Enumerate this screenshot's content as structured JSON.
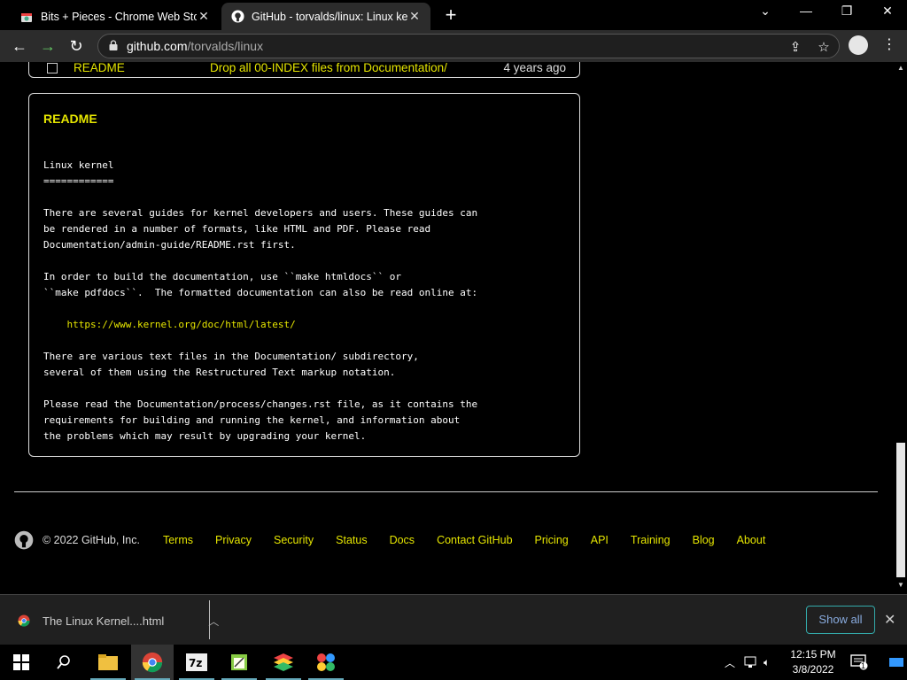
{
  "tabs": [
    {
      "title": "Bits + Pieces - Chrome Web Store",
      "active": false
    },
    {
      "title": "GitHub - torvalds/linux: Linux kernel",
      "active": true
    }
  ],
  "toolbar": {
    "url_host": "github.com",
    "url_path": "/torvalds/linux"
  },
  "file_row": {
    "name": "README",
    "message": "Drop all 00-INDEX files from Documentation/",
    "age": "4 years ago"
  },
  "readme": {
    "heading": "README",
    "title": "Linux kernel",
    "underline": "============",
    "p1": "There are several guides for kernel developers and users. These guides can\nbe rendered in a number of formats, like HTML and PDF. Please read\nDocumentation/admin-guide/README.rst first.",
    "p2": "In order to build the documentation, use ``make htmldocs`` or\n``make pdfdocs``.  The formatted documentation can also be read online at:",
    "link": "https://www.kernel.org/doc/html/latest/",
    "p3": "There are various text files in the Documentation/ subdirectory,\nseveral of them using the Restructured Text markup notation.",
    "p4": "Please read the Documentation/process/changes.rst file, as it contains the\nrequirements for building and running the kernel, and information about\nthe problems which may result by upgrading your kernel."
  },
  "footer": {
    "copyright": "© 2022 GitHub, Inc.",
    "links": [
      "Terms",
      "Privacy",
      "Security",
      "Status",
      "Docs",
      "Contact GitHub",
      "Pricing",
      "API",
      "Training",
      "Blog",
      "About"
    ]
  },
  "download": {
    "filename": "The Linux Kernel....html",
    "show_all": "Show all"
  },
  "taskbar": {
    "time": "12:15 PM",
    "date": "3/8/2022",
    "notifications": "1"
  },
  "colors": {
    "link": "#e5e500",
    "background": "#000000"
  }
}
